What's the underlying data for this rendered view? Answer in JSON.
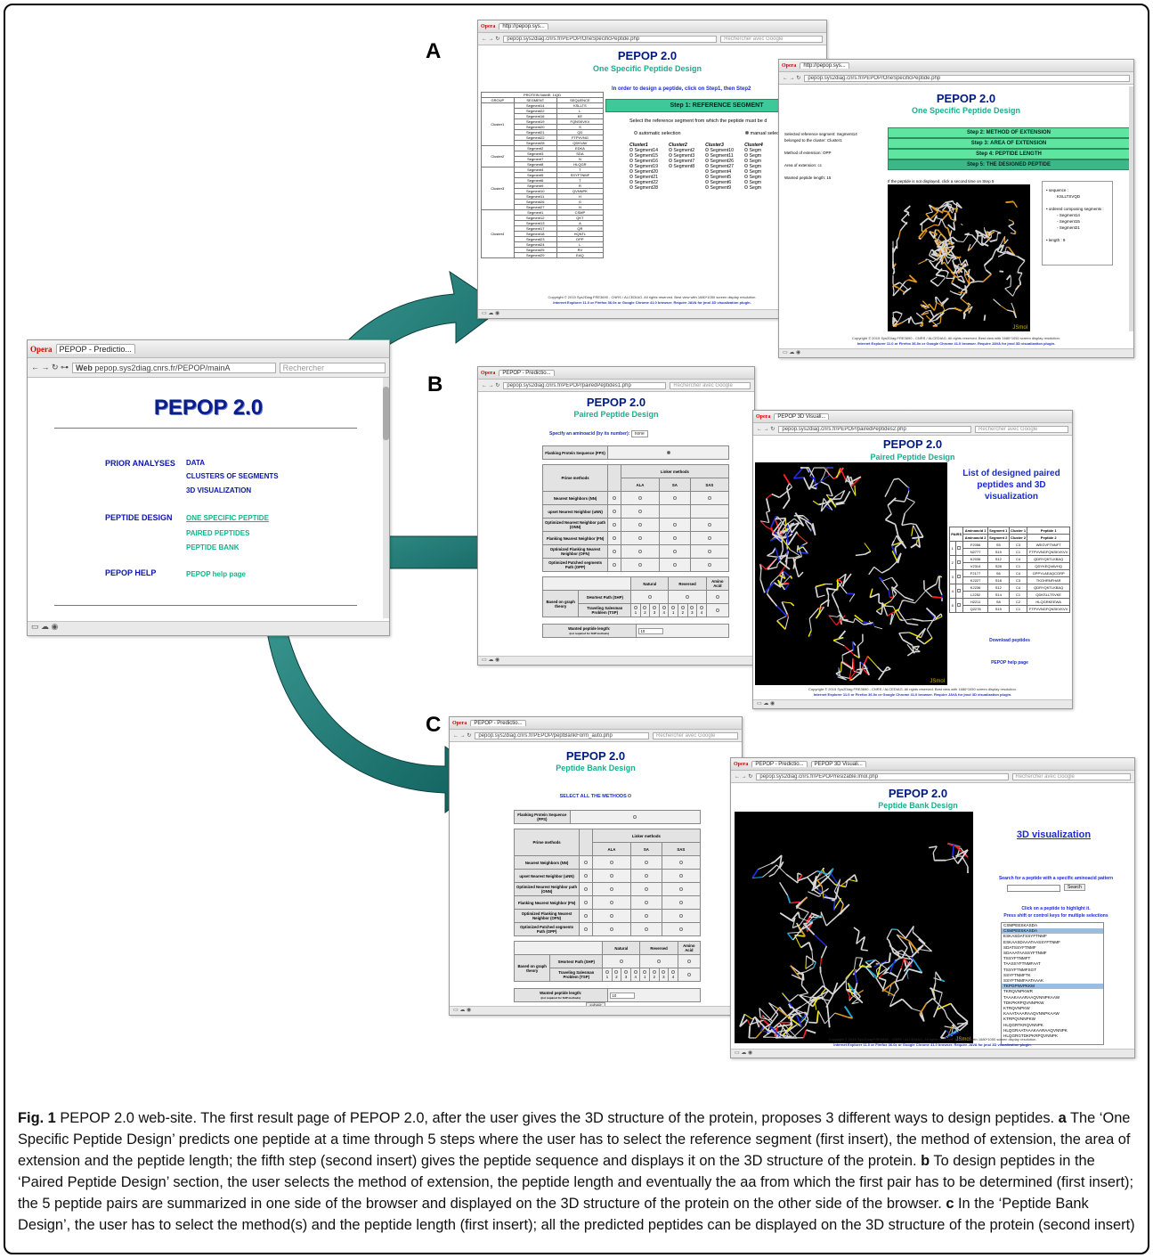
{
  "panel_letters": {
    "a": "A",
    "b": "B",
    "c": "C"
  },
  "main_window": {
    "browser_name": "Opera",
    "tab_title": "PEPOP - Predictio...",
    "url_prefix": "Web",
    "url": "pepop.sys2diag.cnrs.fr/PEPOP/mainA",
    "search_placeholder": "Rechercher",
    "title": "PEPOP 2.0",
    "menu": {
      "prior_label": "PRIOR ANALYSES",
      "prior_links": [
        "DATA",
        "CLUSTERS OF SEGMENTS",
        "3D VISUALIZATION"
      ],
      "design_label": "PEPTIDE DESIGN",
      "design_links": [
        "ONE SPECIFIC PEPTIDE",
        "PAIRED PEPTIDES",
        "PEPTIDE BANK"
      ],
      "help_label": "PEPOP HELP",
      "help_link": "PEPOP help page"
    }
  },
  "panel_a": {
    "win1": {
      "browser_name": "Opera",
      "tab_title": "http://pepop.sys...",
      "url": "pepop.sys2diag.cnrs.fr/PEPOP/OneSpecificPeptide.php",
      "search_placeholder": "Rechercher avec Google",
      "title": "PEPOP 2.0",
      "subtitle": "One Specific Peptide Design",
      "instruction": "In order to design a peptide, click on Step1, then Step2",
      "step1": "Step 1: REFERENCE SEGMENT",
      "select_text": "Select the reference segment from which the peptide must be d",
      "auto_sel": "automatic selection",
      "manual_sel": "manual selecti",
      "protein_name": "PROTEIN NAME: 1IQD",
      "col_headers": [
        "GROUP",
        "SEGMENT",
        "SEQUENCE"
      ],
      "groups": [
        "Cluster1",
        "Cluster2",
        "Cluster3",
        "Cluster4"
      ],
      "cluster_cols": [
        {
          "name": "Cluster1",
          "items": [
            "Segment14",
            "Segment15",
            "Segment16",
            "Segment19",
            "Segment20",
            "Segment21",
            "Segment22",
            "Segment28"
          ]
        },
        {
          "name": "Cluster2",
          "items": [
            "Segment2",
            "Segment3",
            "Segment7",
            "Segment8"
          ]
        },
        {
          "name": "Cluster3",
          "items": [
            "Segment10",
            "Segment11",
            "Segment26",
            "Segment27",
            "Segment4",
            "Segment5",
            "Segment6",
            "Segment9"
          ]
        },
        {
          "name": "Cluster4",
          "items": [
            "Segm",
            "Segm",
            "Segm",
            "Segm",
            "Segm",
            "Segm",
            "Segm",
            "Segm"
          ]
        }
      ],
      "footer1": "Copyright © 2015 Sys2Diag FRE3690 - CNRS / ALCEDIAG. All rights reserved. Best view with 1680*1050 screen display resolution.",
      "footer2": "Internet Explorer 11.0 or Firefox 36.0x or Google Chrome 41.0 browser. Require JAVA for jmol 3D visualization plugin."
    },
    "win2": {
      "browser_name": "Opera",
      "tab_title": "http://pepop.sys...",
      "url": "pepop.sys2diag.cnrs.fr/PEPOP/OneSpecificPeptide.php",
      "title": "PEPOP 2.0",
      "subtitle": "One Specific Peptide Design",
      "info": [
        "Selected reference segment: Segment14",
        "belonged to the cluster: Cluster1",
        "Method of extension: OPP",
        "Area of extension: cc",
        "Wanted peptide length: 15"
      ],
      "steps": [
        "Step 2: METHOD OF EXTENSION",
        "Step 3: AREA OF EXTENSION",
        "Step 4: PEPTIDE LENGTH",
        "Step 5: THE DESIGNED PEPTIDE"
      ],
      "note": "If the peptide is not displayed, click a second time on Step 5",
      "result": {
        "sequence_label": "sequence :",
        "sequence": "KSLLTSVQD",
        "segments_label": "ordered composing segments :",
        "segments": [
          "Segment14",
          "Segment15",
          "Segment21"
        ],
        "length_label": "length : 9"
      },
      "jmol": "JSmol"
    }
  },
  "panel_b": {
    "win1": {
      "browser_name": "Opera",
      "tab_title": "PEPOP - Predictio...",
      "url": "pepop.sys2diag.cnrs.fr/PEPOP/pairedPeptides1.php",
      "search_placeholder": "Rechercher avec Google",
      "title": "PEPOP 2.0",
      "subtitle": "Paired Peptide Design",
      "specify": "Specify an aminoacid (by its number):",
      "specify_value": "none",
      "fps": "Flanking Protein Sequence (FPS)",
      "prime": "Prime methods",
      "linker": "Linker methods",
      "linker_cols": [
        "ALA",
        "SA",
        "SAS"
      ],
      "methods": [
        "Nearest Neighbors (NN)",
        "upset Nearest Neighbor (uNN)",
        "Optimized Nearest Neighbor path (ONN)",
        "Flanking Nearest Neighbor (FN)",
        "Optimized Flanking Nearest Neighbor (OFN)",
        "Optimized Patched segments Path (OPP)"
      ],
      "graph_cols": [
        "Natural",
        "Reversed",
        "Amino Acid"
      ],
      "graph_label": "Based on graph theory",
      "graph_rows": [
        "SHortest Path (SHP)",
        "Traveling Salesman Problem (TSP)"
      ],
      "wanted": "Wanted peptide length:",
      "wanted_note": "(not required for SHP methods)",
      "wanted_value": "10"
    },
    "win2": {
      "browser_name": "Opera",
      "tab_title": "PEPOP 3D Visuali...",
      "url": "pepop.sys2diag.cnrs.fr/PEPOP/pairedPeptides2.php",
      "search_placeholder": "Rechercher avec Google",
      "title": "PEPOP 2.0",
      "subtitle": "Paired Peptide Design",
      "list_title": "List of designed paired peptides and 3D visualization",
      "pairs_label": "PAIRS",
      "pair_headers": [
        "Aminoacid 1",
        "Segment 1",
        "Cluster 1",
        "Peptide 1"
      ],
      "pair_headers2": [
        "Aminoacid 2",
        "Segment 2",
        "Cluster 2",
        "Peptide 2"
      ],
      "pairs": [
        {
          "n": "1",
          "a1": "F2056",
          "s1": "S5",
          "c1": "C3",
          "a2": "N2777",
          "s2": "S19",
          "c2": "C1",
          "p1": "WEGVFTNNFT",
          "p2": "FTPVVNGFQNSKVKVV"
        },
        {
          "n": "2",
          "a1": "K2036",
          "s1": "S12",
          "c1": "C4",
          "a2": "V2314",
          "s2": "S28",
          "c2": "C1",
          "p1": "QDRYQKTLKBAQ",
          "p2": "QDYKEQVAVHQ"
        },
        {
          "n": "3",
          "a1": "F2177",
          "s1": "S6",
          "c1": "C4",
          "a2": "K2227",
          "s2": "S18",
          "c2": "C3",
          "p1": "GPPYLAEAQCGRP",
          "p2": "TKGHRNFHAR"
        },
        {
          "n": "4",
          "a1": "K2236",
          "s1": "S12",
          "c1": "C4",
          "a2": "L2252",
          "s2": "S14",
          "c2": "C1",
          "p1": "QDRYQKTLKBAQ",
          "p2": "QDKSLLTSVKE"
        },
        {
          "n": "5",
          "a1": "H2211",
          "s1": "S8",
          "c1": "C2",
          "a2": "Q2278",
          "s2": "S19",
          "c2": "C1",
          "p1": "HLQGRKEEWA",
          "p2": "FTPVVNGFQNSKVKVV"
        }
      ],
      "download": "Download peptides",
      "help": "PEPOP help page",
      "jmol": "JSmol",
      "footer1": "Copyright © 2015 Sys2Diag FRE3690 - CNRS / ALCEDIAG. All rights reserved. Best view with 1680*1050 screen display resolution.",
      "footer2": "Internet Explorer 11.0 or Firefox 36.0x or Google Chrome 41.0 browser. Require JAVA for jmol 3D visualization plugin."
    }
  },
  "panel_c": {
    "win1": {
      "browser_name": "Opera",
      "tab_title": "PEPOP - Predictio...",
      "url": "pepop.sys2diag.cnrs.fr/PEPOP/peptBankForm_auto.php",
      "search_placeholder": "Rechercher avec Google",
      "title": "PEPOP 2.0",
      "subtitle": "Peptide Bank Design",
      "select_all": "SELECT ALL THE METHODS",
      "fps": "Flanking Protein Sequence (FPS)",
      "prime": "Prime methods",
      "linker": "Linker methods",
      "linker_cols": [
        "ALA",
        "SA",
        "SAS"
      ],
      "methods": [
        "Nearest Neighbors (NN)",
        "upset Nearest Neighbor (uNN)",
        "Optimized Nearest Neighbor path (ONN)",
        "Flanking Nearest Neighbor (FN)",
        "Optimized Flanking Nearest Neighbor (OFN)",
        "Optimized Patched segments Path (OPP)"
      ],
      "graph_cols": [
        "Natural",
        "Reversed",
        "Amino Acid"
      ],
      "graph_label": "Based on graph theory",
      "graph_rows": [
        "SHortest Path (SHP)",
        "Traveling Salesman Problem (TSP)"
      ],
      "wanted": "Wanted peptide length:",
      "wanted_note": "(not required for SHP methods)",
      "wanted_value": "10",
      "submit": "submit"
    },
    "win2": {
      "browser_name": "Opera",
      "tab_title": "PEPOP - Predictio...",
      "tab2_title": "PEPOP 3D Visuali...",
      "url": "pepop.sys2diag.cnrs.fr/PEPOP/resizable.lmol.php",
      "search_placeholder": "Rechercher avec Google",
      "title": "PEPOP 2.0",
      "subtitle": "Peptide Bank Design",
      "viz_title": "3D visualization",
      "search_text": "Search for a peptide with a specific aminoacid pattern",
      "search_btn": "Search",
      "click_text": "Click on a peptide to highlight it.",
      "shift_text": "Press shift or control keys for multiple selections",
      "peptides": [
        "CSMPEESKASDA",
        "CSMPEESKASDA",
        "ESKASDATSSYFTNMF",
        "ESKAASDAAATAASSYFTNMF",
        "SDATSSYFTNMF",
        "SDAAATAASSYFTNMF",
        "TSSYFTNMFT",
        "TAASSYFTNMFAAT",
        "TSSYFTNMFSGT",
        "SSYFTNMFTK",
        "SSYFTNMFAATAAAK",
        "TKPGPNVPKKM",
        "TKRQVNPKWR",
        "TAAAKAAARAAQVNNPKAAW",
        "TDKPKRPQVNNPKW",
        "KTRQVNPKW",
        "KAAATAAARAAQVNNPKAAW",
        "KTRPQVNNPKW",
        "HLQGRTKRQVNNPK",
        "HLQGRAATAAAKAARAAQVNNPK",
        "HLQGRGTDKPKRPQVNNPK"
      ],
      "selected_index": [
        1,
        11
      ],
      "jmol": "JSmol",
      "footer1": "Copyright © 2015 Sys2Diag FRE3690 - CNRS / ALCEDIAG. All rights reserved. Best view with 1680*1050 screen display resolution.",
      "footer2": "Internet Explorer 11.0 or Firefox 36.0x or Google Chrome 41.0 browser. Require JAVA for jmol 3D visualization plugin."
    }
  },
  "caption": {
    "fig": "Fig. 1",
    "intro": " PEPOP 2.0 web-site. The first result page of PEPOP 2.0, after the user gives the 3D structure of the protein, proposes 3 different ways to design peptides. ",
    "a": "a",
    "a_text": " The ‘One Specific Peptide Design’ predicts one peptide at a time through 5 steps where the user has to select the reference segment (first insert), the method of extension, the area of extension and the peptide length; the fifth step (second insert) gives the peptide sequence and displays it on the 3D structure of the protein. ",
    "b": "b",
    "b_text": " To design peptides in the ‘Paired Peptide Design’ section, the user selects the method of extension, the peptide length and eventually the aa from which the first pair has to be determined (first insert); the 5 peptide pairs are summarized in one side of the browser and displayed on the 3D structure of the protein on the other side of the browser. ",
    "c": "c",
    "c_text": " In the ‘Peptide Bank Design’, the user has to select the method(s) and the peptide length (first insert); all the predicted peptides can be displayed on the 3D structure of the protein (second insert)"
  }
}
